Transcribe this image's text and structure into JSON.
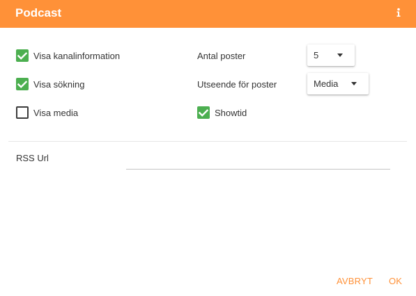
{
  "header": {
    "title": "Podcast",
    "info_icon": "info-icon",
    "background_color": "#ff9138"
  },
  "options": {
    "show_channel_info": {
      "label": "Visa kanalinformation",
      "checked": true
    },
    "show_search": {
      "label": "Visa sökning",
      "checked": true
    },
    "show_media": {
      "label": "Visa media",
      "checked": false
    },
    "showtime": {
      "label": "Showtid",
      "checked": true
    }
  },
  "item_count": {
    "label": "Antal poster",
    "value": "5"
  },
  "item_appearance": {
    "label": "Utseende för poster",
    "value": "Media"
  },
  "rss": {
    "label": "RSS Url",
    "value": ""
  },
  "footer": {
    "cancel_label": "AVBRYT",
    "ok_label": "OK"
  },
  "colors": {
    "accent": "#ff9138",
    "checkbox_checked": "#4caf50"
  }
}
